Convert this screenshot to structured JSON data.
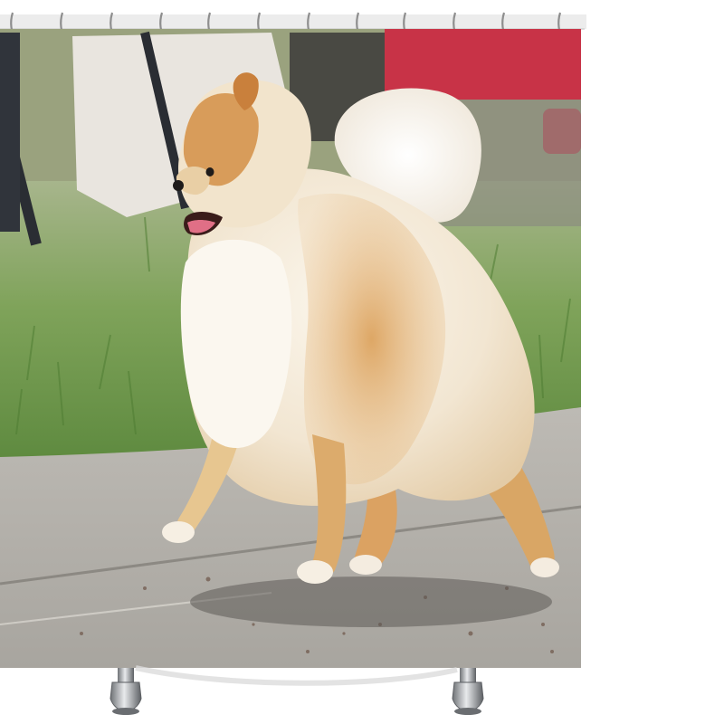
{
  "product": {
    "kind": "shower-curtain",
    "print_subject": "pomeranian-dog-walking-on-pavement",
    "ring_count": 12,
    "foot_count": 2
  },
  "colors": {
    "background": "#ffffff",
    "rod": "#e4e4e4",
    "ring": "#9a9a9a",
    "grass": "#7fa35a",
    "pavement": "#b4b1ab",
    "fur_cream": "#f6eee0",
    "fur_orange": "#d79a52",
    "backdrop_red": "#c83347",
    "chrome": "#b9bcc0"
  }
}
